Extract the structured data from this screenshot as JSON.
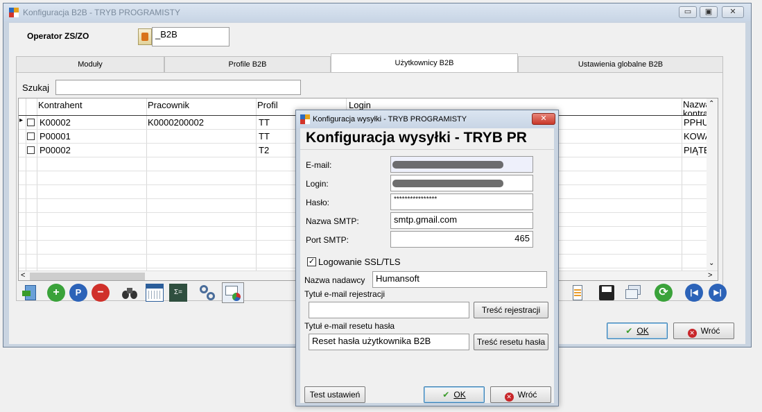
{
  "main_window": {
    "title": "Konfiguracja B2B - TRYB PROGRAMISTY",
    "controls": {
      "minimize": "▭",
      "maximize": "▣",
      "close": "✕"
    },
    "operator_label": "Operator ZS/ZO",
    "operator_value": "_B2B",
    "tabs": [
      {
        "label": "Moduły"
      },
      {
        "label": "Profile B2B"
      },
      {
        "label": "Użytkownicy B2B"
      },
      {
        "label": "Ustawienia globalne B2B"
      }
    ],
    "active_tab": "Użytkownicy B2B",
    "search_label": "Szukaj",
    "search_value": "",
    "grid": {
      "columns": [
        "Kontrahent",
        "Pracownik",
        "Profil",
        "Login",
        "Nazwa kontrahe"
      ],
      "rows": [
        {
          "kontrahent": "K00002",
          "pracownik": "K0000200002",
          "profil": "TT",
          "nazwa": "PPHU L"
        },
        {
          "kontrahent": "P00001",
          "pracownik": "",
          "profil": "TT",
          "nazwa": "KOWAL"
        },
        {
          "kontrahent": "P00002",
          "pracownik": "",
          "profil": "T2",
          "nazwa": "PIĄTEK"
        }
      ]
    },
    "ok_label": "OK",
    "back_label": "Wróć"
  },
  "dialog": {
    "title": "Konfiguracja wysyłki - TRYB PROGRAMISTY",
    "heading": "Konfiguracja wysyłki - TRYB PR",
    "email_label": "E-mail:",
    "login_label": "Login:",
    "password_label": "Hasło:",
    "password_value": "****************",
    "smtp_label": "Nazwa SMTP:",
    "smtp_value": "smtp.gmail.com",
    "port_label": "Port SMTP:",
    "port_value": "465",
    "ssl_label": "Logowanie SSL/TLS",
    "ssl_checked": true,
    "sender_label": "Nazwa nadawcy",
    "sender_value": "Humansoft",
    "reg_title_label": "Tytuł e-mail rejestracji",
    "reg_title_value": "",
    "reg_content_button": "Treść rejestracji",
    "reset_title_label": "Tytuł e-mail resetu hasła",
    "reset_title_value": "Reset hasła użytkownika B2B",
    "reset_content_button": "Treść resetu hasła",
    "test_button": "Test ustawień",
    "ok_label": "OK",
    "back_label": "Wróć"
  }
}
